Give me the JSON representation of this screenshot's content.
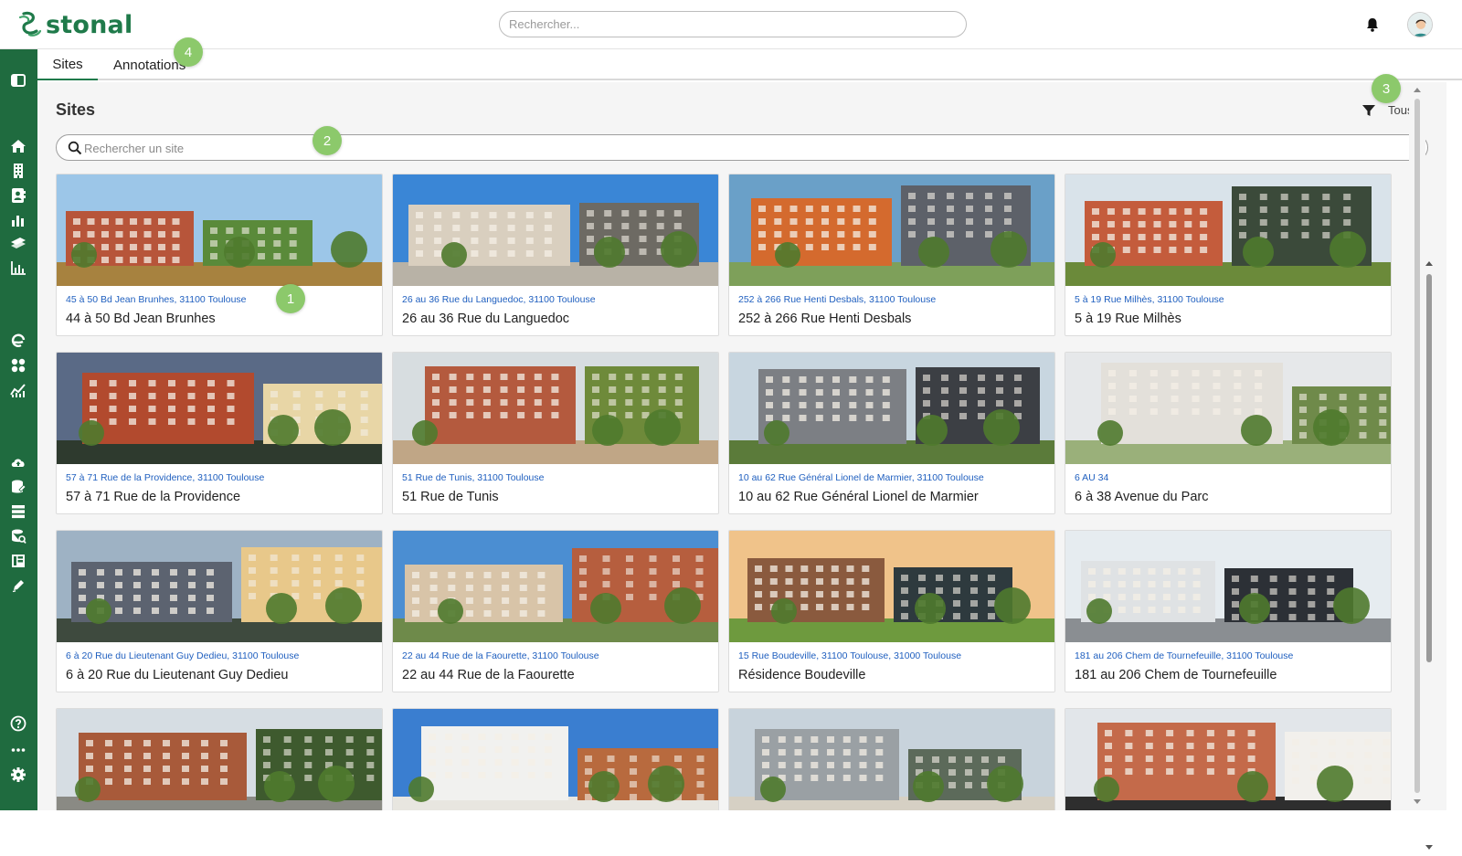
{
  "app": {
    "logo_text": "stonal",
    "brand_color": "#1f7a4a",
    "sidebar_color": "#1f6b3f",
    "link_color": "#1f5fbf",
    "badge_color": "#8cc96b"
  },
  "header": {
    "search_placeholder": "Rechercher...",
    "notification_icon": "bell-icon",
    "user_icon": "avatar"
  },
  "sidebar": {
    "icons": [
      "collapse-icon",
      "home-icon",
      "building-icon",
      "contacts-icon",
      "bar-chart-icon",
      "layers-icon",
      "analytics-icon",
      "refresh-icon",
      "apps-icon",
      "trend-icon",
      "cloud-upload-icon",
      "database-edit-icon",
      "list-icon",
      "database-search-icon",
      "table-icon",
      "pen-icon",
      "help-icon",
      "more-icon",
      "settings-icon"
    ]
  },
  "tabs": [
    {
      "label": "Sites",
      "active": true
    },
    {
      "label": "Annotations",
      "active": false
    }
  ],
  "main": {
    "title": "Sites",
    "filter_label": "Tous",
    "search_placeholder": "Rechercher un site"
  },
  "annotations": {
    "b1": "1",
    "b2": "2",
    "b3": "3",
    "b4": "4"
  },
  "sites": [
    {
      "address": "45 à 50 Bd Jean Brunhes, 31100 Toulouse",
      "name": "44 à 50 Bd Jean Brunhes"
    },
    {
      "address": "26 au 36 Rue du Languedoc, 31100 Toulouse",
      "name": "26 au 36 Rue du Languedoc"
    },
    {
      "address": "252 à 266 Rue Henti Desbals, 31100 Toulouse",
      "name": "252 à 266 Rue Henti Desbals"
    },
    {
      "address": "5 à 19 Rue Milhès, 31100 Toulouse",
      "name": "5 à 19 Rue Milhès"
    },
    {
      "address": "57 à 71 Rue de la Providence, 31100 Toulouse",
      "name": "57 à 71 Rue de la Providence"
    },
    {
      "address": "51 Rue de Tunis, 31100 Toulouse",
      "name": "51 Rue de Tunis"
    },
    {
      "address": "10 au 62 Rue Général Lionel de Marmier, 31100 Toulouse",
      "name": "10 au 62 Rue Général Lionel de Marmier"
    },
    {
      "address": "6 AU 34",
      "name": "6 à 38 Avenue du Parc"
    },
    {
      "address": "6 à 20 Rue du Lieutenant Guy Dedieu, 31100 Toulouse",
      "name": "6 à 20 Rue du Lieutenant Guy Dedieu"
    },
    {
      "address": "22 au 44 Rue de la Faourette, 31100 Toulouse",
      "name": "22 au 44 Rue de la Faourette"
    },
    {
      "address": "15 Rue Boudeville, 31100 Toulouse, 31000 Toulouse",
      "name": "Résidence Boudeville"
    },
    {
      "address": "181 au 206 Chem de Tournefeuille, 31100 Toulouse",
      "name": "181 au 206 Chem de Tournefeuille"
    },
    {
      "address": "",
      "name": ""
    },
    {
      "address": "",
      "name": ""
    },
    {
      "address": "",
      "name": ""
    },
    {
      "address": "",
      "name": ""
    }
  ]
}
